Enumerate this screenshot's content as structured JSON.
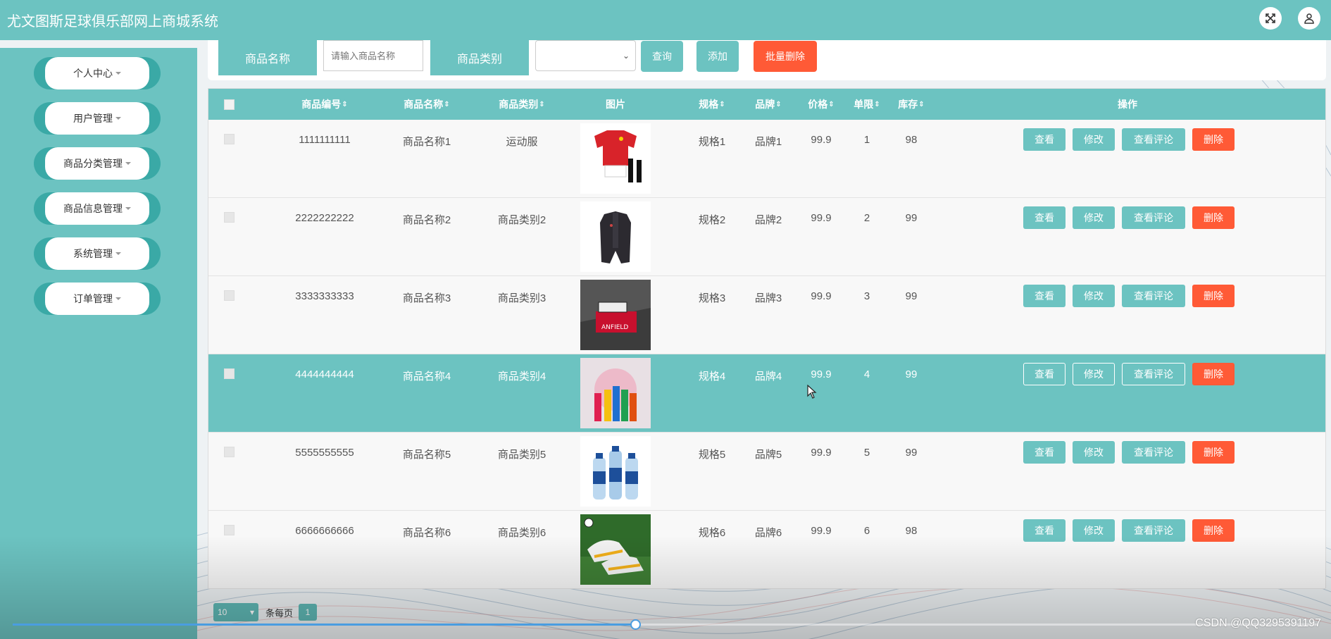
{
  "app": {
    "title": "尤文图斯足球俱乐部网上商城系统"
  },
  "topbar": {
    "fullscreen_icon": "expand-icon",
    "user_icon": "user-icon"
  },
  "sidebar": {
    "items": [
      {
        "label": "个人中心"
      },
      {
        "label": "用户管理"
      },
      {
        "label": "商品分类管理"
      },
      {
        "label": "商品信息管理"
      },
      {
        "label": "系统管理"
      },
      {
        "label": "订单管理"
      }
    ]
  },
  "search": {
    "name_label": "商品名称",
    "name_placeholder": "请输入商品名称",
    "category_label": "商品类别",
    "category_value": "",
    "query_button": "查询",
    "add_button": "添加",
    "batch_delete_button": "批量删除"
  },
  "table": {
    "columns": [
      "商品编号",
      "商品名称",
      "商品类别",
      "图片",
      "规格",
      "品牌",
      "价格",
      "单限",
      "库存",
      "操作"
    ],
    "rows": [
      {
        "code": "1111111111",
        "name": "商品名称1",
        "category": "运动服",
        "image": "red-kit-image",
        "spec": "规格1",
        "brand": "品牌1",
        "price": "99.9",
        "limit": "1",
        "stock": "98"
      },
      {
        "code": "2222222222",
        "name": "商品名称2",
        "category": "商品类别2",
        "image": "dark-coat-image",
        "spec": "规格2",
        "brand": "品牌2",
        "price": "99.9",
        "limit": "2",
        "stock": "99"
      },
      {
        "code": "3333333333",
        "name": "商品名称3",
        "category": "商品类别3",
        "image": "anfield-box-image",
        "spec": "规格3",
        "brand": "品牌3",
        "price": "99.9",
        "limit": "3",
        "stock": "99"
      },
      {
        "code": "4444444444",
        "name": "商品名称4",
        "category": "商品类别4",
        "image": "drink-bottles-image",
        "spec": "规格4",
        "brand": "品牌4",
        "price": "99.9",
        "limit": "4",
        "stock": "99"
      },
      {
        "code": "5555555555",
        "name": "商品名称5",
        "category": "商品类别5",
        "image": "water-bottles-image",
        "spec": "规格5",
        "brand": "品牌5",
        "price": "99.9",
        "limit": "5",
        "stock": "99"
      },
      {
        "code": "6666666666",
        "name": "商品名称6",
        "category": "商品类别6",
        "image": "football-boots-image",
        "spec": "规格6",
        "brand": "品牌6",
        "price": "99.9",
        "limit": "6",
        "stock": "98"
      }
    ],
    "actions": {
      "view": "查看",
      "edit": "修改",
      "view_comments": "查看评论",
      "delete": "删除"
    },
    "highlighted_row": 3
  },
  "pager": {
    "page_size": "10",
    "per_page_label": "条每页",
    "current_page": "1"
  },
  "video": {
    "progress_fraction": 0.477
  },
  "watermark": "CSDN @QQ3295391197",
  "colors": {
    "primary": "#6cc3c1",
    "danger": "#ff5a36",
    "sidebar_pill": "#3aa9a6"
  }
}
